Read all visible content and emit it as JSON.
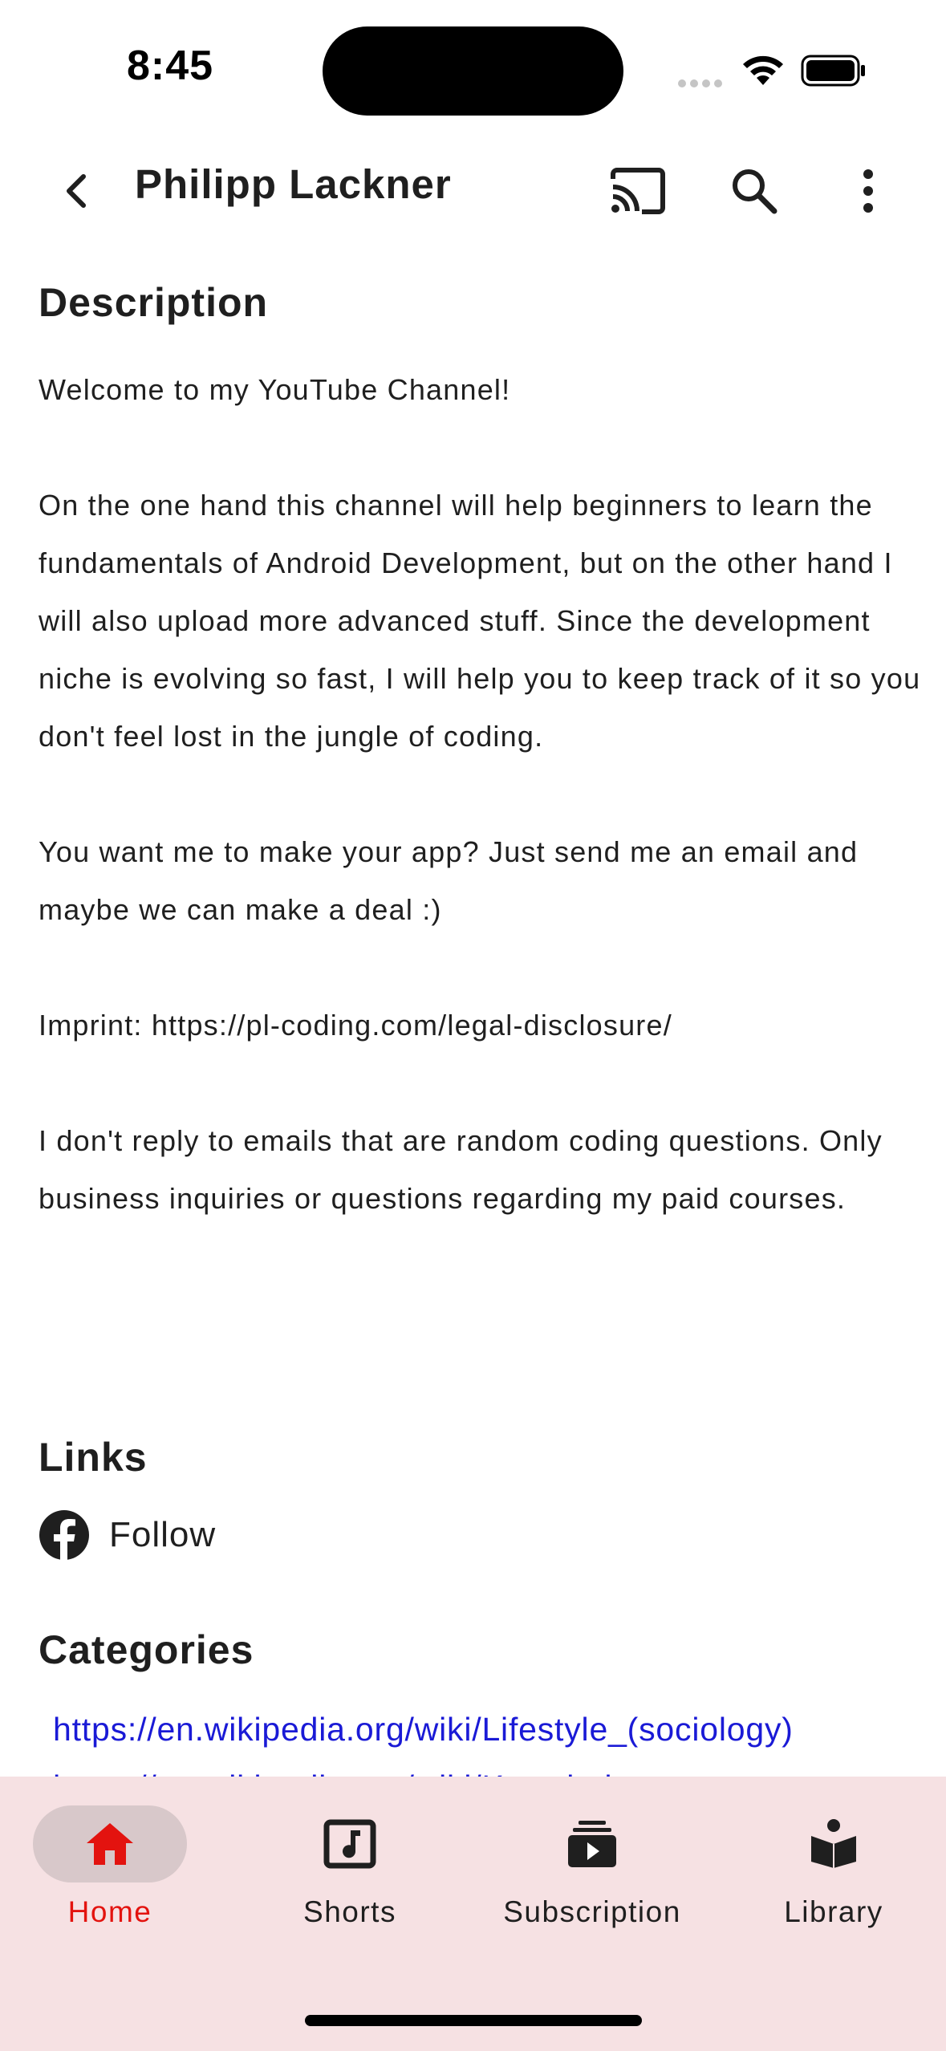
{
  "status_bar": {
    "time": "8:45"
  },
  "app_bar": {
    "title": "Philipp Lackner"
  },
  "description": {
    "heading": "Description",
    "text": "Welcome to my YouTube Channel!\n\nOn the one hand this channel will help beginners to learn the fundamentals of Android Development, but on the other hand I will also upload more advanced stuff. Since the development niche is evolving so fast, I will help you to keep track of it so you don't feel lost in the jungle of coding.\n\nYou want me to make your app? Just send me an email and maybe we can make a deal :)\n\nImprint: https://pl-coding.com/legal-disclosure/\n\nI don't reply to emails that are random coding questions. Only business inquiries or questions regarding my paid courses."
  },
  "links": {
    "heading": "Links",
    "follow_label": "Follow",
    "follow_icon": "facebook-icon"
  },
  "categories": {
    "heading": "Categories",
    "items": [
      "https://en.wikipedia.org/wiki/Lifestyle_(sociology)",
      "https://en.wikipedia.org/wiki/Knowledge"
    ]
  },
  "bottom_nav": {
    "items": [
      {
        "label": "Home",
        "icon": "home-icon",
        "active": true
      },
      {
        "label": "Shorts",
        "icon": "shorts-icon",
        "active": false
      },
      {
        "label": "Subscription",
        "icon": "subscription-icon",
        "active": false
      },
      {
        "label": "Library",
        "icon": "library-icon",
        "active": false
      }
    ]
  },
  "colors": {
    "accent": "#e3130f",
    "link": "#1a1ad6",
    "nav_background": "#f6e1e3",
    "active_pill": "#d8c8ca"
  }
}
